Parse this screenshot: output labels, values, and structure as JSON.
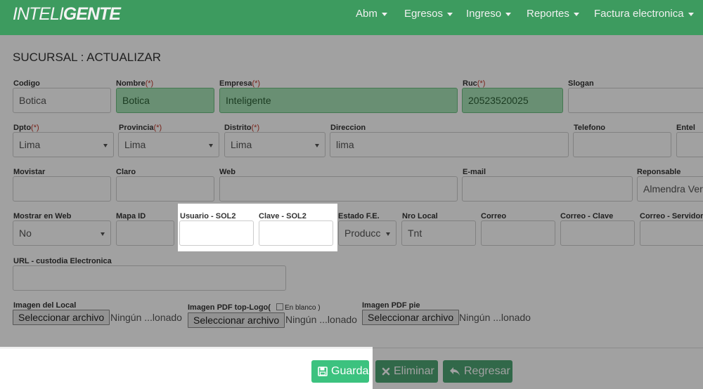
{
  "brand": {
    "part1": "INTELI",
    "part2": "GENTE"
  },
  "nav": {
    "items": [
      {
        "label": "Abm"
      },
      {
        "label": "Egresos"
      },
      {
        "label": "Ingreso"
      },
      {
        "label": "Reportes"
      },
      {
        "label": "Factura electronica"
      }
    ]
  },
  "page": {
    "title": "SUCURSAL : ACTUALIZAR"
  },
  "form": {
    "codigo": {
      "label": "Codigo",
      "value": "Botica"
    },
    "nombre": {
      "label": "Nombre",
      "req": "(*)",
      "value": "Botica"
    },
    "empresa": {
      "label": "Empresa",
      "req": "(*)",
      "value": "Inteligente"
    },
    "ruc": {
      "label": "Ruc",
      "req": "(*)",
      "value": "20523520025"
    },
    "slogan": {
      "label": "Slogan",
      "value": ""
    },
    "dpto": {
      "label": "Dpto",
      "req": "(*)",
      "value": "Lima"
    },
    "provincia": {
      "label": "Provincia",
      "req": "(*)",
      "value": "Lima"
    },
    "distrito": {
      "label": "Distrito",
      "req": "(*)",
      "value": "Lima"
    },
    "direccion": {
      "label": "Direccion",
      "value": "lima"
    },
    "telefono": {
      "label": "Telefono",
      "value": ""
    },
    "entel": {
      "label": "Entel",
      "value": ""
    },
    "movistar": {
      "label": "Movistar",
      "value": ""
    },
    "claro": {
      "label": "Claro",
      "value": ""
    },
    "web": {
      "label": "Web",
      "value": ""
    },
    "email": {
      "label": "E-mail",
      "value": ""
    },
    "reponsable": {
      "label": "Reponsable",
      "value": "Almendra Ver"
    },
    "mostrar_web": {
      "label": "Mostrar en Web",
      "value": "No"
    },
    "mapa_id": {
      "label": "Mapa ID",
      "value": ""
    },
    "usuario_sol2": {
      "label": "Usuario - SOL2",
      "value": ""
    },
    "clave_sol2": {
      "label": "Clave - SOL2",
      "value": ""
    },
    "estado_fe": {
      "label": "Estado F.E.",
      "value": "Producc"
    },
    "nro_local": {
      "label": "Nro Local",
      "value": "Tnt"
    },
    "correo": {
      "label": "Correo",
      "value": ""
    },
    "correo_clave": {
      "label": "Correo - Clave",
      "value": ""
    },
    "correo_servidor": {
      "label": "Correo - Servidor",
      "value": ""
    },
    "url_custodia": {
      "label": "URL - custodia Electronica",
      "value": ""
    },
    "imagen_local": {
      "label": "Imagen del Local",
      "button": "Seleccionar archivo",
      "status": "Ningún ...lonado"
    },
    "imagen_pdf_top": {
      "label": "Imagen PDF top-Logo(",
      "blank_label": "En blanco )",
      "button": "Seleccionar archivo",
      "status": "Ningún ...lonado"
    },
    "imagen_pdf_pie": {
      "label": "Imagen PDF pie",
      "button": "Seleccionar archivo",
      "status": "Ningún ...lonado"
    }
  },
  "actions": {
    "save": "Guardar",
    "delete": "Eliminar",
    "back": "Regresar"
  },
  "colors": {
    "navbar": "#3d9b5f",
    "required_fill": "#a6e3b7",
    "save_button": "#3cc27f",
    "secondary_button": "#4ea574"
  }
}
